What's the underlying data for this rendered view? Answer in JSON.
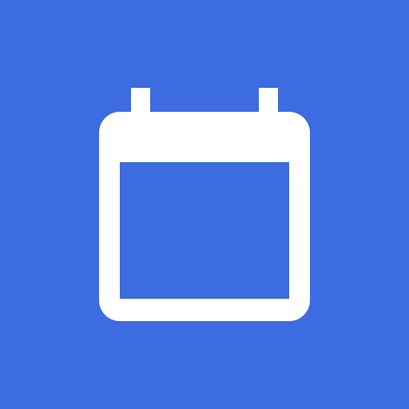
{
  "app_icon": {
    "icon": "calendar-icon",
    "background_color": "#3D6BE0",
    "glyph_color": "#FFFFFF"
  }
}
